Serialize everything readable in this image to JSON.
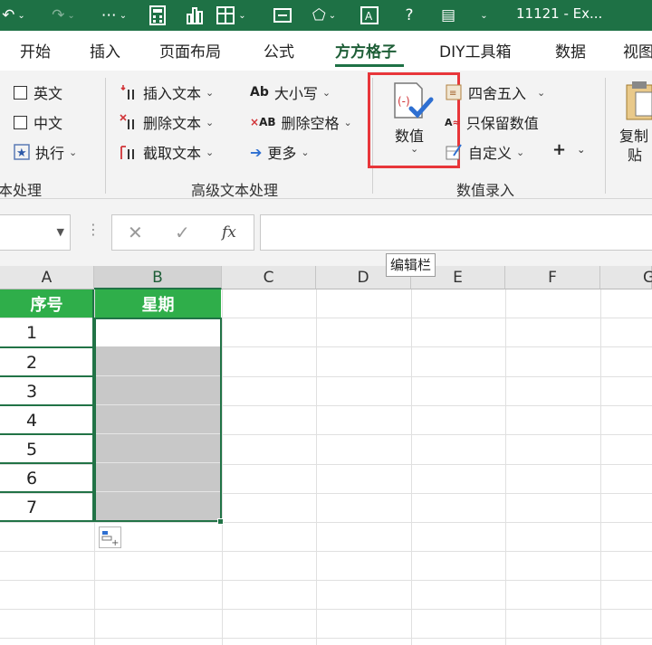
{
  "window": {
    "title": "11121 - Ex..."
  },
  "tabs": [
    {
      "label": "开始"
    },
    {
      "label": "插入"
    },
    {
      "label": "页面布局"
    },
    {
      "label": "公式"
    },
    {
      "label": "方方格子"
    },
    {
      "label": "DIY工具箱"
    },
    {
      "label": "数据"
    },
    {
      "label": "视图"
    }
  ],
  "active_tab": "方方格子",
  "ribbon": {
    "group1": {
      "english": "英文",
      "chinese": "中文",
      "execute": "执行",
      "label": "本处理"
    },
    "group2": {
      "insert_text": "插入文本",
      "delete_text": "删除文本",
      "extract_text": "截取文本",
      "case": "大小写",
      "delete_spaces": "删除空格",
      "more": "更多",
      "label": "高级文本处理"
    },
    "group3": {
      "numeric": "数值",
      "round": "四舍五入",
      "keep_numbers": "只保留数值",
      "custom": "自定义",
      "plus": "+",
      "label": "数值录入"
    },
    "group4": {
      "copy_line1": "复制",
      "copy_line2": "贴"
    }
  },
  "formula_bar": {
    "fx": "fx",
    "cancel": "✕",
    "confirm": "✓",
    "tooltip": "编辑栏"
  },
  "columns": [
    "A",
    "B",
    "C",
    "D",
    "E",
    "F",
    "G"
  ],
  "table": {
    "headers": [
      "序号",
      "星期"
    ],
    "rows": [
      "1",
      "2",
      "3",
      "4",
      "5",
      "6",
      "7"
    ]
  },
  "colors": {
    "excel_green": "#1e7145",
    "header_fill": "#2fae4a",
    "highlight": "#e8363a",
    "selection_fill": "#c8c8c8"
  }
}
